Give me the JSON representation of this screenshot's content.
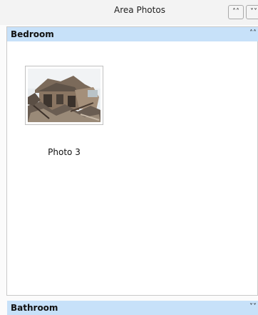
{
  "window": {
    "title": "Area Photos",
    "collapse_all_icon": "double-chevron-up-icon",
    "expand_all_icon": "double-chevron-down-icon"
  },
  "sections": [
    {
      "label": "Bedroom",
      "state_icon": "double-chevron-up-icon",
      "expanded": true,
      "photos": [
        {
          "caption": "Photo 3"
        }
      ]
    },
    {
      "label": "Bathroom",
      "state_icon": "double-chevron-down-icon",
      "expanded": false
    }
  ],
  "icons": {
    "collapse_glyph": "»",
    "chevrons_up": "˄˄",
    "chevrons_down": "˅˅"
  }
}
